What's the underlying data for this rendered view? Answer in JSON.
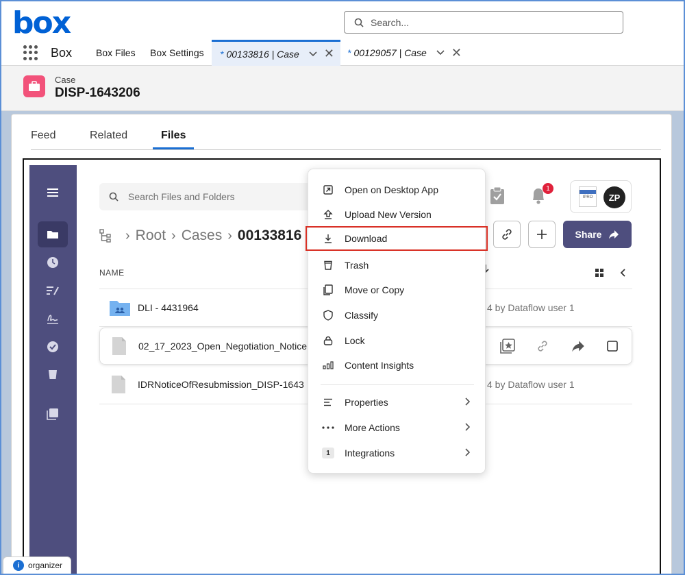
{
  "app": {
    "logo": "box",
    "name": "Box",
    "search_placeholder": "Search..."
  },
  "nav": {
    "tabs": [
      {
        "label": "Box Files"
      },
      {
        "label": "Box Settings"
      },
      {
        "label": "00133816 | Case",
        "prefix": "*"
      },
      {
        "label": "00129057 | Case",
        "prefix": "*"
      }
    ]
  },
  "record": {
    "type": "Case",
    "name": "DISP-1643206"
  },
  "subtabs": [
    "Feed",
    "Related",
    "Files"
  ],
  "box": {
    "search_placeholder": "Search Files and Folders",
    "breadcrumb": [
      "Root",
      "Cases",
      "00133816"
    ],
    "column_name": "NAME",
    "notification_count": "1",
    "avatar_initials": "ZP",
    "share_label": "Share",
    "files": [
      {
        "name": "DLI - 4431964",
        "meta": "4 by Dataflow user 1",
        "kind": "folder"
      },
      {
        "name": "02_17_2023_Open_Negotiation_Notice",
        "meta": "",
        "kind": "file"
      },
      {
        "name": "IDRNoticeOfResubmission_DISP-1643",
        "meta": "4 by Dataflow user 1",
        "kind": "file"
      }
    ]
  },
  "menu": {
    "items": [
      {
        "label": "Open on Desktop App",
        "icon": "external-icon"
      },
      {
        "label": "Upload New Version",
        "icon": "upload-icon"
      },
      {
        "label": "Download",
        "icon": "download-icon"
      },
      {
        "label": "Trash",
        "icon": "trash-icon"
      },
      {
        "label": "Move or Copy",
        "icon": "copy-icon"
      },
      {
        "label": "Classify",
        "icon": "shield-icon"
      },
      {
        "label": "Lock",
        "icon": "lock-icon"
      },
      {
        "label": "Content Insights",
        "icon": "insights-icon"
      },
      {
        "label": "Properties",
        "icon": "properties-icon"
      },
      {
        "label": "More Actions",
        "icon": "ellipsis-icon"
      },
      {
        "label": "Integrations",
        "icon": "integrations-icon",
        "badge": "1"
      }
    ]
  },
  "footer": {
    "organizer_label": "organizer"
  },
  "colors": {
    "brand": "#0061d5",
    "box_purple": "#4e4e7e",
    "highlight": "#d93025",
    "case_icon": "#f2527a"
  }
}
